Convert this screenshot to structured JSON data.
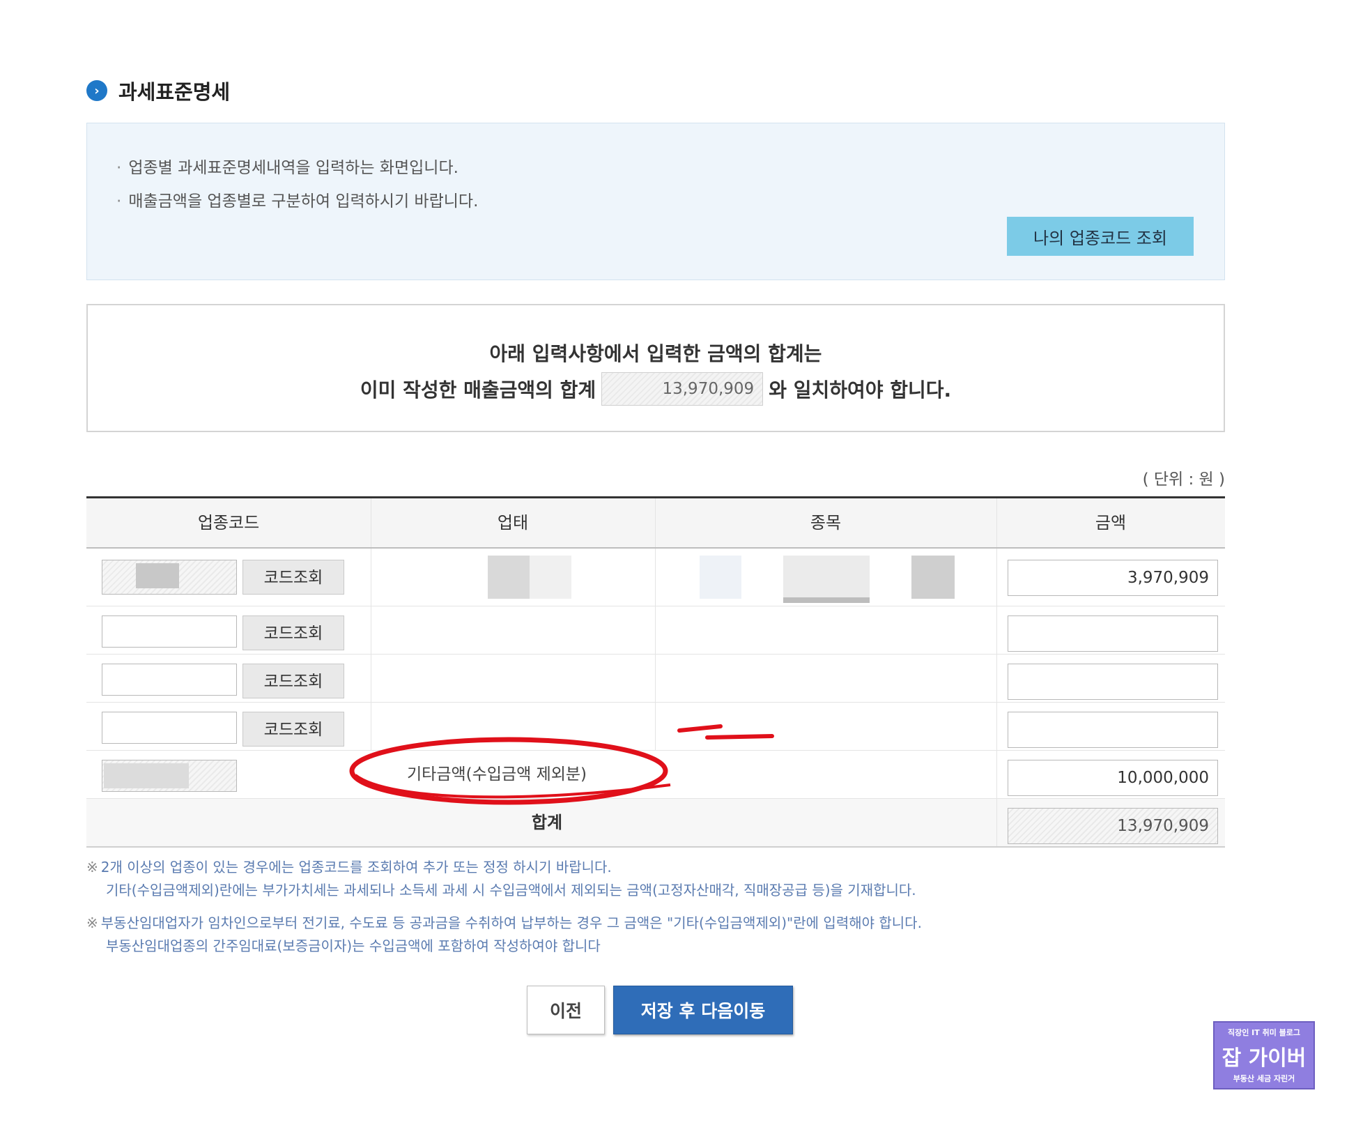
{
  "section": {
    "title": "과세표준명세"
  },
  "guide": {
    "lines": [
      "업종별 과세표준명세내역을 입력하는 화면입니다.",
      "매출금액을 업종별로 구분하여 입력하시기 바랍니다."
    ],
    "bullet": "·",
    "my_code_button": "나의 업종코드 조회"
  },
  "notice": {
    "line1": "아래 입력사항에서  입력한 금액의 합계는",
    "line2_prefix": "이미 작성한 매출금액의 합계",
    "sum_value": "13,970,909",
    "line2_suffix": "와 일치하여야 합니다."
  },
  "unit_label": "( 단위 : 원 )",
  "table": {
    "headers": {
      "code": "업종코드",
      "type": "업태",
      "item": "종목",
      "amount": "금액"
    },
    "code_button": "코드조회",
    "rows": [
      {
        "amount": "3,970,909"
      },
      {
        "amount": ""
      },
      {
        "amount": ""
      },
      {
        "amount": ""
      }
    ],
    "etc_row": {
      "label": "기타금액(수입금액 제외분)",
      "amount": "10,000,000"
    },
    "total_row": {
      "label": "합계",
      "amount": "13,970,909"
    }
  },
  "notes": [
    {
      "mark": "※",
      "line1": "2개 이상의 업종이 있는 경우에는 업종코드를 조회하여 추가 또는 정정 하시기 바랍니다.",
      "line2": "기타(수입금액제외)란에는 부가가치세는 과세되나 소득세 과세 시 수입금액에서 제외되는 금액(고정자산매각, 직매장공급 등)을 기재합니다."
    },
    {
      "mark": "※",
      "line1": "부동산임대업자가 임차인으로부터 전기료, 수도료 등 공과금을 수취하여 납부하는 경우 그 금액은 \"기타(수입금액제외)\"란에 입력해야 합니다.",
      "line2": "부동산임대업종의 간주임대료(보증금이자)는 수입금액에 포함하여 작성하여야 합니다"
    }
  ],
  "buttons": {
    "prev": "이전",
    "save_next": "저장 후 다음이동"
  },
  "logo": {
    "top": "직장인 IT 취미 블로그",
    "main": "잡 가이버",
    "bottom": "부동산 세금 자린거"
  },
  "colors": {
    "accent_blue": "#2f6db8",
    "highlight_circle": "#e0101a",
    "guide_bg": "#eef5fb",
    "code_query_btn": "#7ccbe7"
  }
}
